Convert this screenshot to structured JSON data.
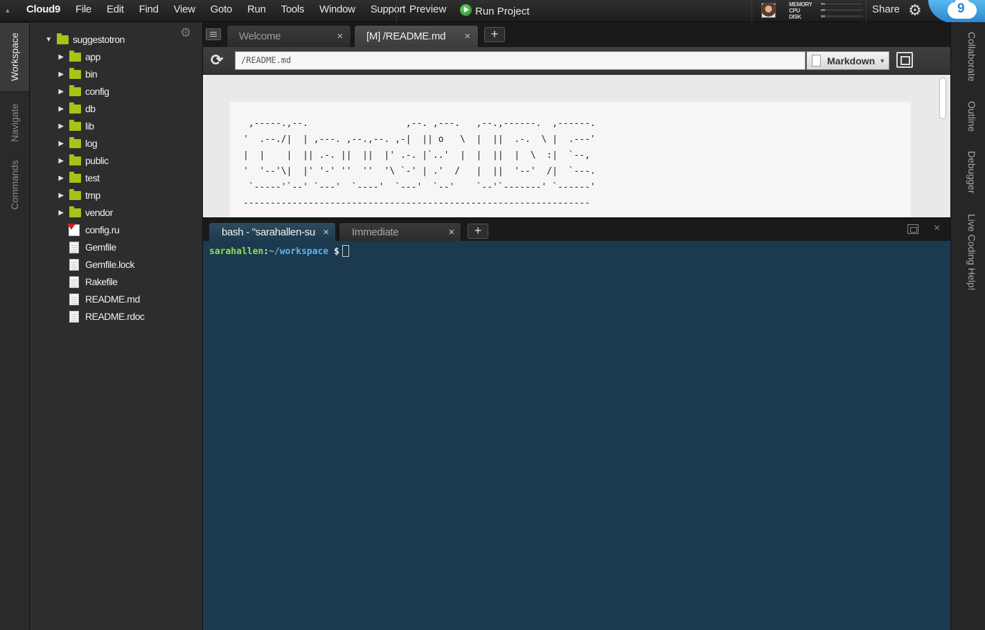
{
  "app": {
    "brand": "Cloud9",
    "menus": [
      "File",
      "Edit",
      "Find",
      "View",
      "Goto",
      "Run",
      "Tools",
      "Window",
      "Support"
    ],
    "preview": "Preview",
    "run_project": "Run Project",
    "share": "Share",
    "stats": {
      "memory": "MEMORY",
      "cpu": "CPU",
      "disk": "DISK",
      "memory_level": 0.1,
      "cpu_level": 0.1,
      "disk_level": 0.1
    },
    "cloud_number": "9"
  },
  "left_rail": {
    "tabs": [
      "Workspace",
      "Navigate",
      "Commands"
    ]
  },
  "tree": {
    "root": "suggestotron",
    "folders": [
      "app",
      "bin",
      "config",
      "db",
      "lib",
      "log",
      "public",
      "test",
      "tmp",
      "vendor"
    ],
    "files": [
      "config.ru",
      "Gemfile",
      "Gemfile.lock",
      "Rakefile",
      "README.md",
      "README.rdoc"
    ]
  },
  "editor": {
    "tabs": [
      {
        "label": "Welcome",
        "active": false
      },
      {
        "label": "[M] /README.md",
        "active": true
      }
    ],
    "add_tab": "+",
    "url": "/README.md",
    "mode": "Markdown",
    "ascii_art": " ,-----.,--.                  ,--. ,---.   ,--.,------.  ,------.\n'  .--./|  | ,---. ,--.,--. ,-|  || o   \\  |  ||  .-.  \\ |  .---'\n|  |    |  || .-. ||  ||  |' .-. |`..'  |  |  ||  |  \\  :|  `--,\n'  '--'\\|  |' '-' ''  ''  '\\ `-' | .'  /   |  ||  '--'  /|  `---.\n `-----'`--' `---'  `----'  `---'  `--'    `--'`-------' `------'\n----------------------------------------------------------------"
  },
  "terminal": {
    "tabs": [
      {
        "label": "bash - \"sarahallen-su",
        "active": true
      },
      {
        "label": "Immediate",
        "active": false
      }
    ],
    "add_tab": "+",
    "user": "sarahallen",
    "colon": ":",
    "path": "~/workspace",
    "dollar": " $"
  },
  "right_rail": {
    "tabs": [
      "Collaborate",
      "Outline",
      "Debugger",
      "Live Coding Help!"
    ]
  }
}
